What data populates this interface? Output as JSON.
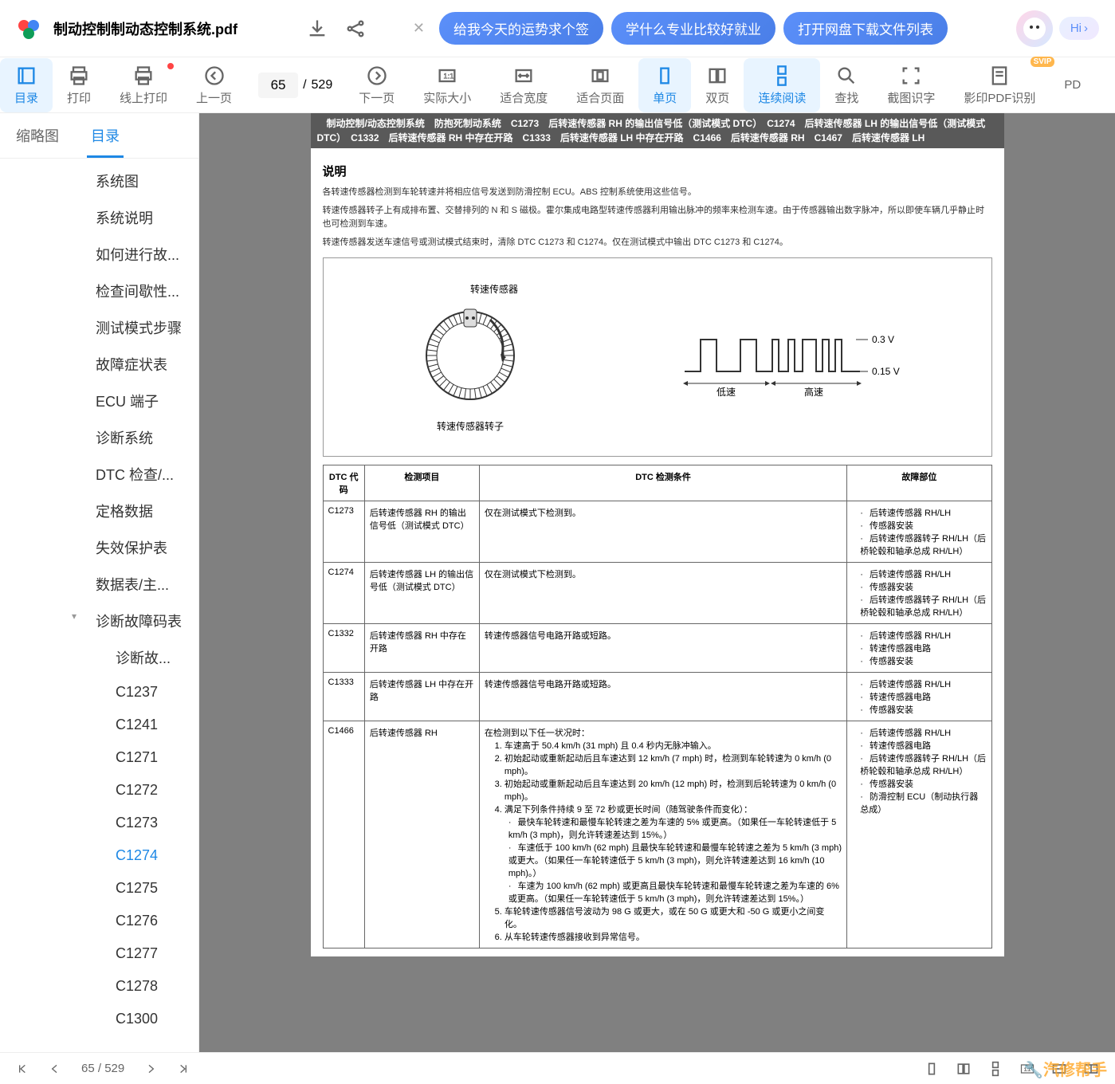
{
  "header": {
    "title": "制动控制制动态控制系统.pdf",
    "suggestions": [
      "给我今天的运势求个签",
      "学什么专业比较好就业",
      "打开网盘下载文件列表"
    ],
    "hi": "Hi"
  },
  "toolbar": {
    "items": [
      {
        "label": "目录"
      },
      {
        "label": "打印"
      },
      {
        "label": "线上打印"
      },
      {
        "label": "上一页"
      },
      {
        "label": "下一页"
      },
      {
        "label": "实际大小"
      },
      {
        "label": "适合宽度"
      },
      {
        "label": "适合页面"
      },
      {
        "label": "单页"
      },
      {
        "label": "双页"
      },
      {
        "label": "连续阅读"
      },
      {
        "label": "查找"
      },
      {
        "label": "截图识字"
      },
      {
        "label": "影印PDF识别"
      },
      {
        "label": "PD"
      }
    ],
    "page_current": "65",
    "page_total": "529"
  },
  "sidebar": {
    "tabs": [
      "缩略图",
      "目录"
    ],
    "outline": [
      {
        "t": "系统图",
        "l": 1
      },
      {
        "t": "系统说明",
        "l": 1
      },
      {
        "t": "如何进行故...",
        "l": 1
      },
      {
        "t": "检查间歇性...",
        "l": 1
      },
      {
        "t": "测试模式步骤",
        "l": 1
      },
      {
        "t": "故障症状表",
        "l": 1
      },
      {
        "t": "ECU 端子",
        "l": 1
      },
      {
        "t": "诊断系统",
        "l": 1
      },
      {
        "t": "DTC 检查/...",
        "l": 1
      },
      {
        "t": "定格数据",
        "l": 1
      },
      {
        "t": "失效保护表",
        "l": 1
      },
      {
        "t": "数据表/主...",
        "l": 1
      },
      {
        "t": "诊断故障码表",
        "l": 1,
        "chev": true
      },
      {
        "t": "诊断故...",
        "l": 2
      },
      {
        "t": "C1237",
        "l": 2
      },
      {
        "t": "C1241",
        "l": 2
      },
      {
        "t": "C1271",
        "l": 2
      },
      {
        "t": "C1272",
        "l": 2
      },
      {
        "t": "C1273",
        "l": 2
      },
      {
        "t": "C1274",
        "l": 2,
        "active": true
      },
      {
        "t": "C1275",
        "l": 2
      },
      {
        "t": "C1276",
        "l": 2
      },
      {
        "t": "C1277",
        "l": 2
      },
      {
        "t": "C1278",
        "l": 2
      },
      {
        "t": "C1300",
        "l": 2
      }
    ]
  },
  "doc": {
    "banner": "　制动控制/动态控制系统　防抱死制动系统　C1273　后转速传感器 RH 的输出信号低（测试模式 DTC）　C1274　后转速传感器 LH 的输出信号低（测试模式 DTC）　C1332　后转速传感器 RH 中存在开路　C1333　后转速传感器 LH 中存在开路　C1466　后转速传感器 RH　C1467　后转速传感器 LH",
    "section": "说明",
    "p1": "各转速传感器检测到车轮转速并将相应信号发送到防滑控制 ECU。ABS 控制系统使用这些信号。",
    "p2": "转速传感器转子上有成排布置、交替排列的 N 和 S 磁极。霍尔集成电路型转速传感器利用输出脉冲的频率来检测车速。由于传感器输出数字脉冲，所以即使车辆几乎静止时也可检测到车速。",
    "p3": "转速传感器发送车速信号或测试模式结束时，清除 DTC C1273 和 C1274。仅在测试模式中输出 DTC C1273 和 C1274。",
    "diag": {
      "sensor": "转速传感器",
      "rotor": "转速传感器转子",
      "low": "低速",
      "high": "高速",
      "v1": "0.3 V",
      "v2": "0.15 V"
    },
    "th": [
      "DTC 代码",
      "检测项目",
      "DTC 检测条件",
      "故障部位"
    ],
    "rows": [
      {
        "c": "C1273",
        "i": "后转速传感器 RH 的输出信号低（测试模式 DTC）",
        "d": "仅在测试模式下检测到。",
        "f": [
          "后转速传感器 RH/LH",
          "传感器安装",
          "后转速传感器转子 RH/LH（后桥轮毂和轴承总成 RH/LH）"
        ]
      },
      {
        "c": "C1274",
        "i": "后转速传感器 LH 的输出信号低（测试模式 DTC）",
        "d": "仅在测试模式下检测到。",
        "f": [
          "后转速传感器 RH/LH",
          "传感器安装",
          "后转速传感器转子 RH/LH（后桥轮毂和轴承总成 RH/LH）"
        ]
      },
      {
        "c": "C1332",
        "i": "后转速传感器 RH 中存在开路",
        "d": "转速传感器信号电路开路或短路。",
        "f": [
          "后转速传感器 RH/LH",
          "转速传感器电路",
          "传感器安装"
        ]
      },
      {
        "c": "C1333",
        "i": "后转速传感器 LH 中存在开路",
        "d": "转速传感器信号电路开路或短路。",
        "f": [
          "后转速传感器 RH/LH",
          "转速传感器电路",
          "传感器安装"
        ]
      }
    ],
    "c1466": {
      "c": "C1466",
      "i": "后转速传感器 RH",
      "intro": "在检测到以下任一状况时：",
      "ol": [
        "车速高于 50.4 km/h (31 mph) 且 0.4 秒内无脉冲输入。",
        "初始起动或重新起动后且车速达到 12 km/h (7 mph) 时，检测到车轮转速为 0 km/h (0 mph)。",
        "初始起动或重新起动后且车速达到 20 km/h (12 mph) 时，检测到后轮转速为 0 km/h (0 mph)。",
        "满足下列条件持续 9 至 72 秒或更长时间（随驾驶条件而变化）："
      ],
      "sub": [
        "最快车轮转速和最慢车轮转速之差为车速的 5% 或更高。（如果任一车轮转速低于 5 km/h (3 mph)，则允许转速差达到 15%。）",
        "车速低于 100 km/h (62 mph) 且最快车轮转速和最慢车轮转速之差为 5 km/h (3 mph) 或更大。（如果任一车轮转速低于 5 km/h (3 mph)，则允许转速差达到 16 km/h (10 mph)。）",
        "车速为 100 km/h (62 mph) 或更高且最快车轮转速和最慢车轮转速之差为车速的 6% 或更高。（如果任一车轮转速低于 5 km/h (3 mph)，则允许转速差达到 15%。）"
      ],
      "ol2": [
        "车轮转速传感器信号波动为 98 G 或更大，或在 50 G 或更大和 -50 G 或更小之间变化。",
        "从车轮转速传感器接收到异常信号。"
      ],
      "f": [
        "后转速传感器 RH/LH",
        "转速传感器电路",
        "后转速传感器转子 RH/LH（后桥轮毂和轴承总成 RH/LH）",
        "传感器安装",
        "防滑控制 ECU（制动执行器总成）"
      ]
    }
  },
  "footer": {
    "page": "65",
    "sep": "/",
    "total": "529"
  },
  "watermark": "汽修帮手"
}
